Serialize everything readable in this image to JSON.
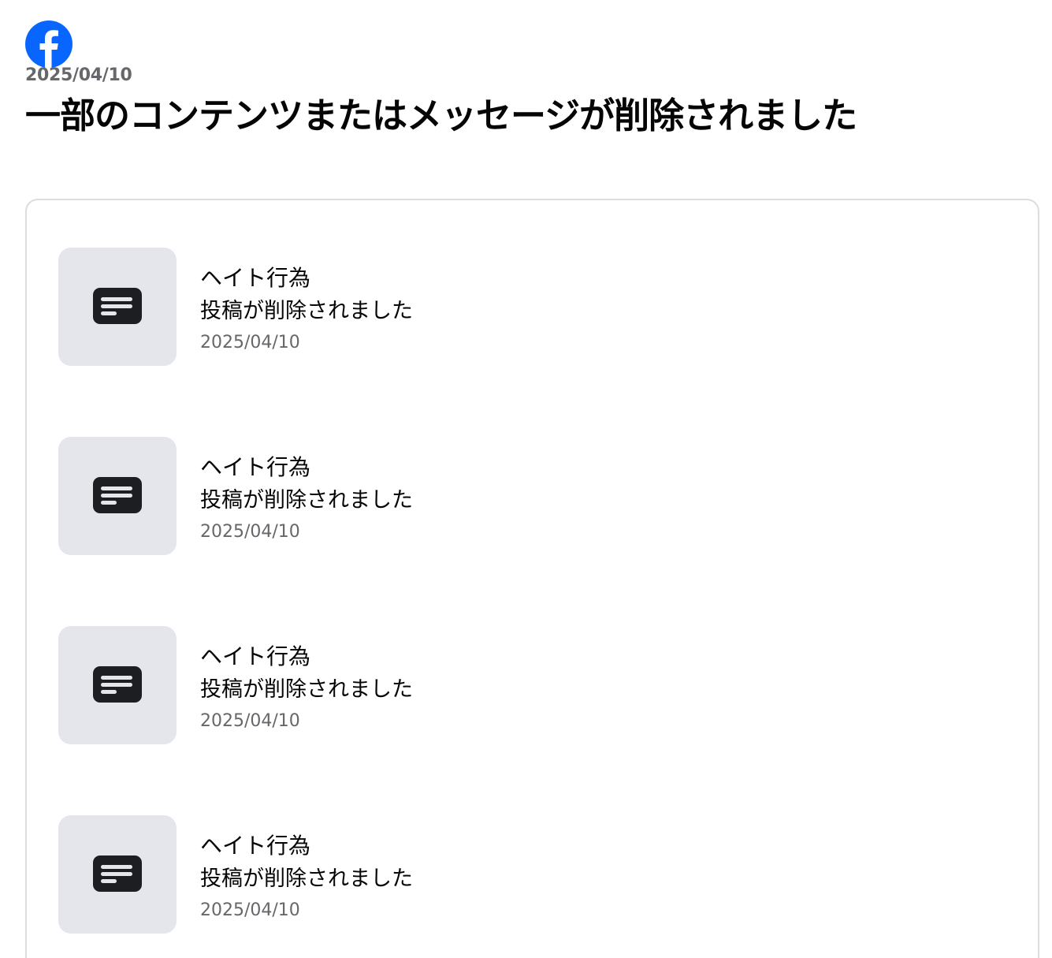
{
  "brand": {
    "logo_icon": "facebook-logo-icon",
    "color": "#0866ff"
  },
  "header": {
    "date": "2025/04/10",
    "title": "一部のコンテンツまたはメッセージが削除されました"
  },
  "items": [
    {
      "icon": "message-icon",
      "title": "ヘイト行為",
      "status": "投稿が削除されました",
      "date": "2025/04/10"
    },
    {
      "icon": "message-icon",
      "title": "ヘイト行為",
      "status": "投稿が削除されました",
      "date": "2025/04/10"
    },
    {
      "icon": "message-icon",
      "title": "ヘイト行為",
      "status": "投稿が削除されました",
      "date": "2025/04/10"
    },
    {
      "icon": "message-icon",
      "title": "ヘイト行為",
      "status": "投稿が削除されました",
      "date": "2025/04/10"
    }
  ]
}
